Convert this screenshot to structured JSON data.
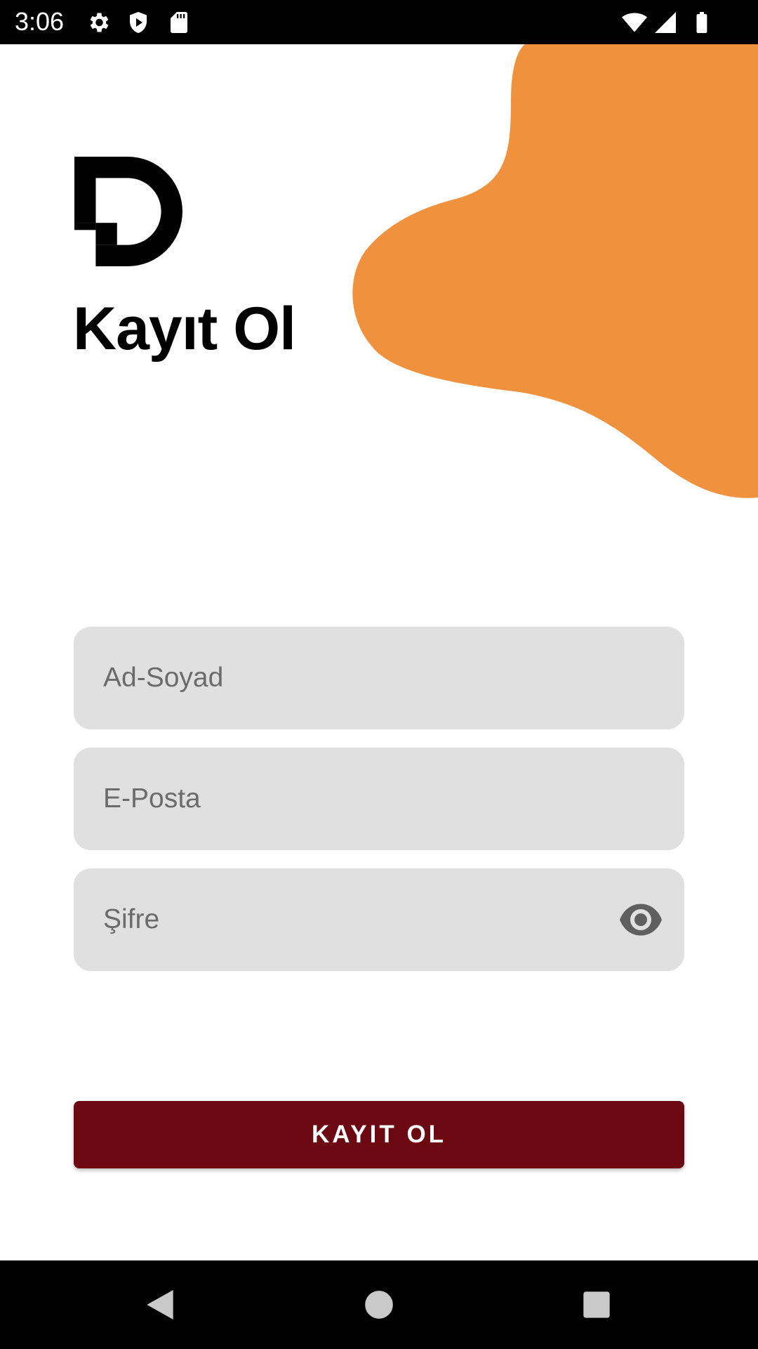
{
  "status_bar": {
    "time": "3:06",
    "left_icons": [
      "gear-icon",
      "shield-play-icon",
      "sd-card-icon"
    ],
    "right_icons": [
      "wifi-icon",
      "signal-icon",
      "battery-icon"
    ]
  },
  "header": {
    "logo": "d-logo",
    "title": "Kayıt Ol"
  },
  "form": {
    "name_placeholder": "Ad-Soyad",
    "email_placeholder": "E-Posta",
    "password_placeholder": "Şifre",
    "password_toggle_icon": "eye-icon"
  },
  "actions": {
    "register_label": "KAYIT OL"
  },
  "nav_bar": {
    "buttons": [
      "back-icon",
      "home-icon",
      "recents-icon"
    ]
  },
  "colors": {
    "accent_blob": "#f0913e",
    "primary_button": "#6b0811",
    "field_background": "#e0e0e0",
    "text_primary": "#000000"
  }
}
